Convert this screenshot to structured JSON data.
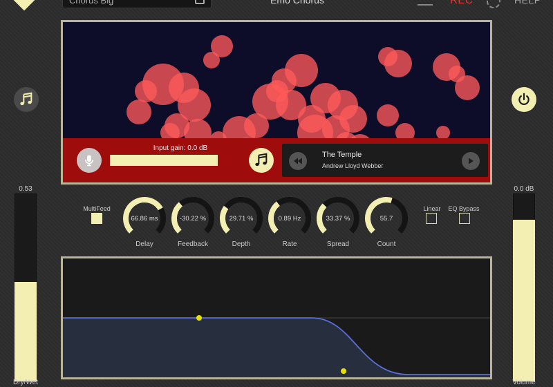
{
  "header": {
    "preset_name": "Chorus Big",
    "app_title": "Emo Chorus",
    "rec_label": "REC",
    "help_label": "HELP"
  },
  "visualizer": {
    "input_gain_label": "Input gain:",
    "input_gain_value": "0.0 dB"
  },
  "player": {
    "track_title": "The Temple",
    "track_artist": "Andrew Lloyd Webber"
  },
  "meters": {
    "dry_wet": {
      "value_text": "0.53",
      "label": "Dry/Wet",
      "level": 0.53
    },
    "volume": {
      "value_text": "0.0 dB",
      "label": "Volume",
      "level": 0.86
    }
  },
  "controls": {
    "multifeed": {
      "label": "MultiFeed",
      "checked": true
    },
    "linear": {
      "label": "Linear",
      "checked": false
    },
    "eq_bypass": {
      "label": "EQ Bypass",
      "checked": false
    },
    "knobs": [
      {
        "key": "delay",
        "value": "66.86 ms",
        "label": "Delay",
        "level": 0.72
      },
      {
        "key": "feedback",
        "value": "-30.22 %",
        "label": "Feedback",
        "level": 0.35
      },
      {
        "key": "depth",
        "value": "29.71 %",
        "label": "Depth",
        "level": 0.3
      },
      {
        "key": "rate",
        "value": "0.89  Hz",
        "label": "Rate",
        "level": 0.36
      },
      {
        "key": "spread",
        "value": "33.37 %",
        "label": "Spread",
        "level": 0.33
      },
      {
        "key": "count",
        "value": "55.7",
        "label": "Count",
        "level": 0.56
      }
    ]
  },
  "colors": {
    "accent": "#f3efb2",
    "rec": "#e53a3a",
    "viz_background": "#0d0d2a",
    "bubble": "#ff5a5a",
    "input_bar": "#9f0c0c",
    "eq_curve": "#5a6fd8",
    "eq_handle": "#e8e000"
  },
  "icons": {
    "logo": "logo-icon",
    "save": "save-icon",
    "menu": "menu-icon",
    "settings": "gear-icon",
    "music": "music-note-icon",
    "power": "power-icon",
    "mic": "microphone-icon",
    "prev": "previous-icon",
    "next": "play-next-icon"
  }
}
